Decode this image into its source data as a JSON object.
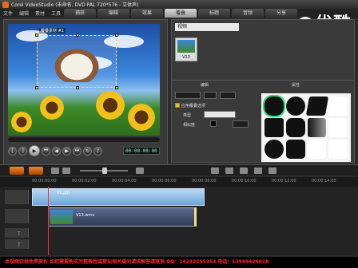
{
  "app": {
    "title": "Corel VideoStudio (未命名, DVD PAL 720*576 - 立体声)",
    "menu": [
      "文件",
      "编辑",
      "素材",
      "工具"
    ],
    "tabs": [
      "捕获",
      "编辑",
      "效果",
      "覆叠",
      "标题",
      "音频",
      "分享"
    ],
    "active_tab": "覆叠",
    "brand_watermark": "优酷"
  },
  "preview": {
    "overlay_label": "覆叠素材 #1",
    "timecode": "00:00:00:00"
  },
  "library": {
    "selector": "视频",
    "thumb_caption": "V13"
  },
  "options": {
    "header_left": "编辑",
    "header_right": "属性",
    "apply_mask_label": "应用覆叠选项",
    "type_label": "类型",
    "similarity_label": "相似度"
  },
  "timeline": {
    "ruler_ticks": [
      "00:00:00:00",
      "00:00:02:00",
      "00:00:04:00",
      "00:00:06:00",
      "00:00:08:00",
      "00:00:10:00",
      "00:00:12:00",
      "00:00:14:00"
    ],
    "video_clip_label": "V1.jpg",
    "overlay_clip_label": "V13.wmv",
    "track_labels": [
      "",
      "",
      "T",
      "T"
    ]
  },
  "footer": {
    "notice": "本视频仅供免费赏析 如您需要购买完整教程或提出相关疑问请求解答请联系 QQ：14232255354 电话：13999426018"
  }
}
